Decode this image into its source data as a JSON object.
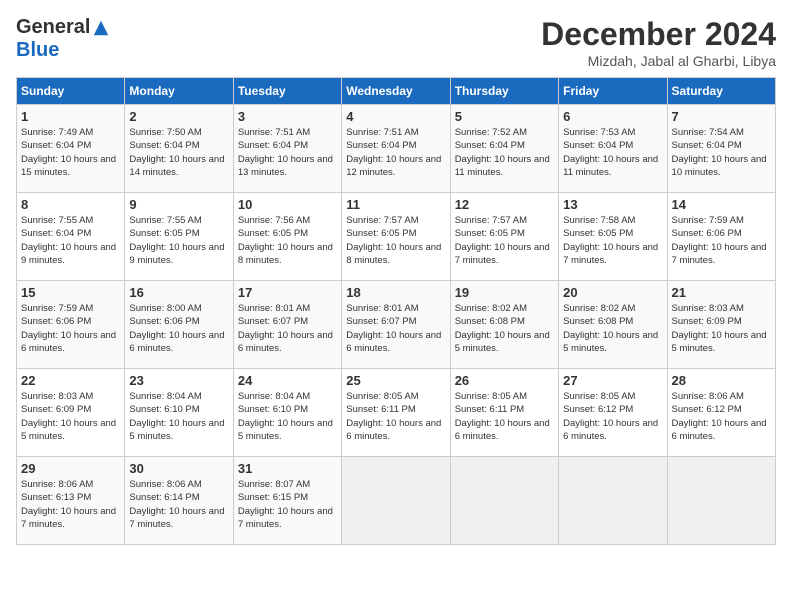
{
  "header": {
    "logo_general": "General",
    "logo_blue": "Blue",
    "month_title": "December 2024",
    "location": "Mizdah, Jabal al Gharbi, Libya"
  },
  "calendar": {
    "days_of_week": [
      "Sunday",
      "Monday",
      "Tuesday",
      "Wednesday",
      "Thursday",
      "Friday",
      "Saturday"
    ],
    "weeks": [
      [
        {
          "day": "1",
          "sunrise": "Sunrise: 7:49 AM",
          "sunset": "Sunset: 6:04 PM",
          "daylight": "Daylight: 10 hours and 15 minutes."
        },
        {
          "day": "2",
          "sunrise": "Sunrise: 7:50 AM",
          "sunset": "Sunset: 6:04 PM",
          "daylight": "Daylight: 10 hours and 14 minutes."
        },
        {
          "day": "3",
          "sunrise": "Sunrise: 7:51 AM",
          "sunset": "Sunset: 6:04 PM",
          "daylight": "Daylight: 10 hours and 13 minutes."
        },
        {
          "day": "4",
          "sunrise": "Sunrise: 7:51 AM",
          "sunset": "Sunset: 6:04 PM",
          "daylight": "Daylight: 10 hours and 12 minutes."
        },
        {
          "day": "5",
          "sunrise": "Sunrise: 7:52 AM",
          "sunset": "Sunset: 6:04 PM",
          "daylight": "Daylight: 10 hours and 11 minutes."
        },
        {
          "day": "6",
          "sunrise": "Sunrise: 7:53 AM",
          "sunset": "Sunset: 6:04 PM",
          "daylight": "Daylight: 10 hours and 11 minutes."
        },
        {
          "day": "7",
          "sunrise": "Sunrise: 7:54 AM",
          "sunset": "Sunset: 6:04 PM",
          "daylight": "Daylight: 10 hours and 10 minutes."
        }
      ],
      [
        {
          "day": "8",
          "sunrise": "Sunrise: 7:55 AM",
          "sunset": "Sunset: 6:04 PM",
          "daylight": "Daylight: 10 hours and 9 minutes."
        },
        {
          "day": "9",
          "sunrise": "Sunrise: 7:55 AM",
          "sunset": "Sunset: 6:05 PM",
          "daylight": "Daylight: 10 hours and 9 minutes."
        },
        {
          "day": "10",
          "sunrise": "Sunrise: 7:56 AM",
          "sunset": "Sunset: 6:05 PM",
          "daylight": "Daylight: 10 hours and 8 minutes."
        },
        {
          "day": "11",
          "sunrise": "Sunrise: 7:57 AM",
          "sunset": "Sunset: 6:05 PM",
          "daylight": "Daylight: 10 hours and 8 minutes."
        },
        {
          "day": "12",
          "sunrise": "Sunrise: 7:57 AM",
          "sunset": "Sunset: 6:05 PM",
          "daylight": "Daylight: 10 hours and 7 minutes."
        },
        {
          "day": "13",
          "sunrise": "Sunrise: 7:58 AM",
          "sunset": "Sunset: 6:05 PM",
          "daylight": "Daylight: 10 hours and 7 minutes."
        },
        {
          "day": "14",
          "sunrise": "Sunrise: 7:59 AM",
          "sunset": "Sunset: 6:06 PM",
          "daylight": "Daylight: 10 hours and 7 minutes."
        }
      ],
      [
        {
          "day": "15",
          "sunrise": "Sunrise: 7:59 AM",
          "sunset": "Sunset: 6:06 PM",
          "daylight": "Daylight: 10 hours and 6 minutes."
        },
        {
          "day": "16",
          "sunrise": "Sunrise: 8:00 AM",
          "sunset": "Sunset: 6:06 PM",
          "daylight": "Daylight: 10 hours and 6 minutes."
        },
        {
          "day": "17",
          "sunrise": "Sunrise: 8:01 AM",
          "sunset": "Sunset: 6:07 PM",
          "daylight": "Daylight: 10 hours and 6 minutes."
        },
        {
          "day": "18",
          "sunrise": "Sunrise: 8:01 AM",
          "sunset": "Sunset: 6:07 PM",
          "daylight": "Daylight: 10 hours and 6 minutes."
        },
        {
          "day": "19",
          "sunrise": "Sunrise: 8:02 AM",
          "sunset": "Sunset: 6:08 PM",
          "daylight": "Daylight: 10 hours and 5 minutes."
        },
        {
          "day": "20",
          "sunrise": "Sunrise: 8:02 AM",
          "sunset": "Sunset: 6:08 PM",
          "daylight": "Daylight: 10 hours and 5 minutes."
        },
        {
          "day": "21",
          "sunrise": "Sunrise: 8:03 AM",
          "sunset": "Sunset: 6:09 PM",
          "daylight": "Daylight: 10 hours and 5 minutes."
        }
      ],
      [
        {
          "day": "22",
          "sunrise": "Sunrise: 8:03 AM",
          "sunset": "Sunset: 6:09 PM",
          "daylight": "Daylight: 10 hours and 5 minutes."
        },
        {
          "day": "23",
          "sunrise": "Sunrise: 8:04 AM",
          "sunset": "Sunset: 6:10 PM",
          "daylight": "Daylight: 10 hours and 5 minutes."
        },
        {
          "day": "24",
          "sunrise": "Sunrise: 8:04 AM",
          "sunset": "Sunset: 6:10 PM",
          "daylight": "Daylight: 10 hours and 5 minutes."
        },
        {
          "day": "25",
          "sunrise": "Sunrise: 8:05 AM",
          "sunset": "Sunset: 6:11 PM",
          "daylight": "Daylight: 10 hours and 6 minutes."
        },
        {
          "day": "26",
          "sunrise": "Sunrise: 8:05 AM",
          "sunset": "Sunset: 6:11 PM",
          "daylight": "Daylight: 10 hours and 6 minutes."
        },
        {
          "day": "27",
          "sunrise": "Sunrise: 8:05 AM",
          "sunset": "Sunset: 6:12 PM",
          "daylight": "Daylight: 10 hours and 6 minutes."
        },
        {
          "day": "28",
          "sunrise": "Sunrise: 8:06 AM",
          "sunset": "Sunset: 6:12 PM",
          "daylight": "Daylight: 10 hours and 6 minutes."
        }
      ],
      [
        {
          "day": "29",
          "sunrise": "Sunrise: 8:06 AM",
          "sunset": "Sunset: 6:13 PM",
          "daylight": "Daylight: 10 hours and 7 minutes."
        },
        {
          "day": "30",
          "sunrise": "Sunrise: 8:06 AM",
          "sunset": "Sunset: 6:14 PM",
          "daylight": "Daylight: 10 hours and 7 minutes."
        },
        {
          "day": "31",
          "sunrise": "Sunrise: 8:07 AM",
          "sunset": "Sunset: 6:15 PM",
          "daylight": "Daylight: 10 hours and 7 minutes."
        },
        null,
        null,
        null,
        null
      ]
    ]
  }
}
